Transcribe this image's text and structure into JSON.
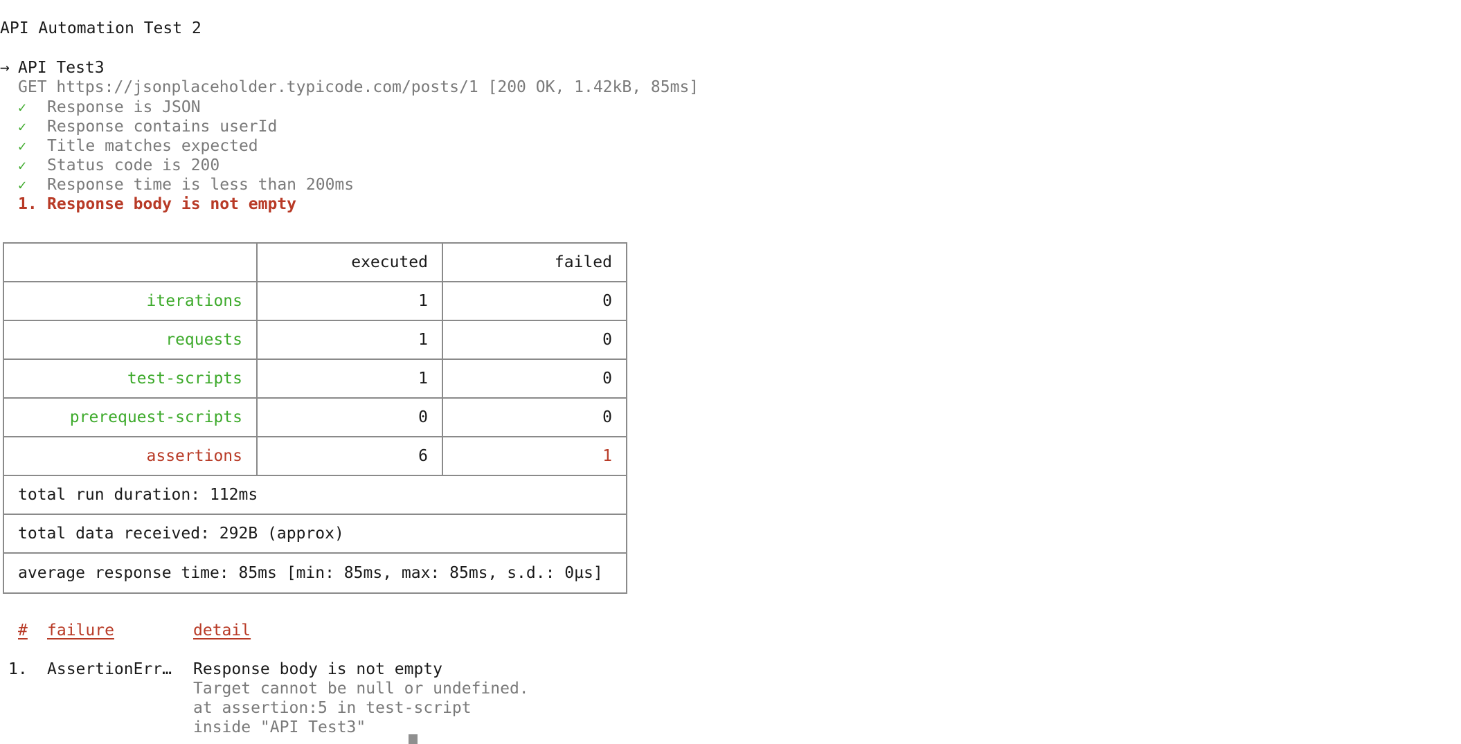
{
  "collection_title": "API Automation Test 2",
  "request": {
    "arrow": "→",
    "name": "API Test3",
    "summary": "GET https://jsonplaceholder.typicode.com/posts/1 [200 OK, 1.42kB, 85ms]"
  },
  "assertions": [
    {
      "status": "pass",
      "mark": "✓",
      "text": "Response is JSON"
    },
    {
      "status": "pass",
      "mark": "✓",
      "text": "Response contains userId"
    },
    {
      "status": "pass",
      "mark": "✓",
      "text": "Title matches expected"
    },
    {
      "status": "pass",
      "mark": "✓",
      "text": "Status code is 200"
    },
    {
      "status": "pass",
      "mark": "✓",
      "text": "Response time is less than 200ms"
    },
    {
      "status": "fail",
      "mark": "1.",
      "text": "Response body is not empty"
    }
  ],
  "summary_table": {
    "headers": [
      "",
      "executed",
      "failed"
    ],
    "rows": [
      {
        "label": "iterations",
        "executed": "1",
        "failed": "0"
      },
      {
        "label": "requests",
        "executed": "1",
        "failed": "0"
      },
      {
        "label": "test-scripts",
        "executed": "1",
        "failed": "0"
      },
      {
        "label": "prerequest-scripts",
        "executed": "0",
        "failed": "0"
      },
      {
        "label": "assertions",
        "executed": "6",
        "failed": "1"
      }
    ],
    "total_run_duration": "total run duration: 112ms",
    "total_data_received": "total data received: 292B (approx)",
    "average_response_time": "average response time: 85ms [min: 85ms, max: 85ms, s.d.: 0µs]"
  },
  "failures": {
    "headers": {
      "num": "#",
      "failure": "failure",
      "detail": "detail"
    },
    "items": [
      {
        "num": "1.",
        "failure": "AssertionErr…",
        "detail": "Response body is not empty",
        "detail_lines": [
          "Target cannot be null or undefined.",
          "at assertion:5 in test-script",
          "inside \"API Test3\""
        ]
      }
    ]
  },
  "colors": {
    "pass": "#3daa2b",
    "fail": "#b83a26",
    "muted": "#7a7a7a",
    "border": "#8a8a8a"
  }
}
